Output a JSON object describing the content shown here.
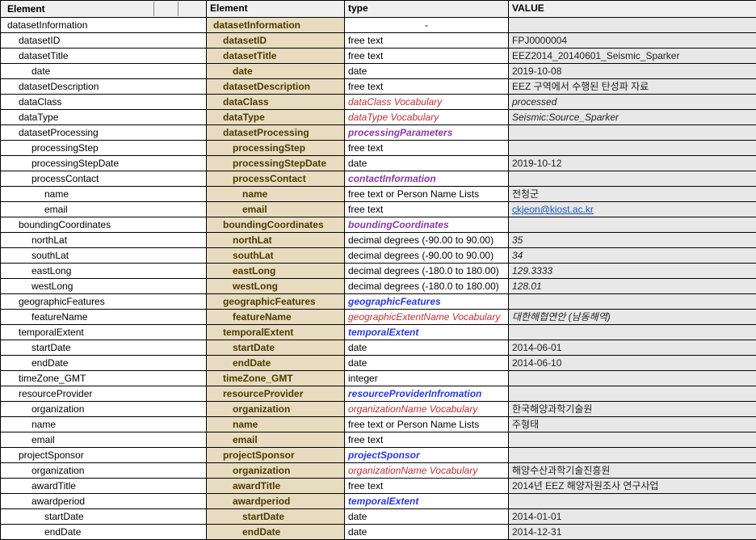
{
  "headers": {
    "colA": "Element",
    "colB": "Element",
    "colC": "type",
    "colD": "VALUE"
  },
  "rows": [
    {
      "tree": "datasetInformation",
      "ti": 0,
      "el": "datasetInformation",
      "ind": 0,
      "type": "-",
      "tstyle": "center",
      "val": ""
    },
    {
      "tree": "datasetID",
      "ti": 1,
      "el": "datasetID",
      "ind": 1,
      "type": "free text",
      "tstyle": "normal",
      "val": "FPJ0000004"
    },
    {
      "tree": "datasetTitle",
      "ti": 1,
      "el": "datasetTitle",
      "ind": 1,
      "type": "free text",
      "tstyle": "normal",
      "val": "EEZ2014_20140601_Seismic_Sparker"
    },
    {
      "tree": "date",
      "ti": 2,
      "el": "date",
      "ind": 2,
      "type": "date",
      "tstyle": "normal",
      "val": "2019-10-08"
    },
    {
      "tree": "datasetDescription",
      "ti": 1,
      "el": "datasetDescription",
      "ind": 1,
      "type": "free text",
      "tstyle": "normal",
      "val": "EEZ 구역에서 수행된 탄성파 자료"
    },
    {
      "tree": "dataClass",
      "ti": 1,
      "el": "dataClass",
      "ind": 1,
      "type": "dataClass Vocabulary",
      "tstyle": "red",
      "val": "processed",
      "vitalic": true
    },
    {
      "tree": "dataType",
      "ti": 1,
      "el": "dataType",
      "ind": 1,
      "type": "dataType Vocabulary",
      "tstyle": "red",
      "val": "Seismic:Source_Sparker",
      "vitalic": true
    },
    {
      "tree": "datasetProcessing",
      "ti": 1,
      "el": "datasetProcessing",
      "ind": 1,
      "type": "processingParameters",
      "tstyle": "purple",
      "val": ""
    },
    {
      "tree": "processingStep",
      "ti": 2,
      "el": "processingStep",
      "ind": 2,
      "type": "free text",
      "tstyle": "normal",
      "val": ""
    },
    {
      "tree": "processingStepDate",
      "ti": 2,
      "el": "processingStepDate",
      "ind": 2,
      "type": "date",
      "tstyle": "normal",
      "val": "2019-10-12"
    },
    {
      "tree": "processContact",
      "ti": 2,
      "el": "processContact",
      "ind": 2,
      "type": "contactInformation",
      "tstyle": "purple",
      "val": ""
    },
    {
      "tree": "name",
      "ti": 3,
      "el": "name",
      "ind": 3,
      "type": "free text or Person Name Lists",
      "tstyle": "normal",
      "val": "전청군"
    },
    {
      "tree": "email",
      "ti": 3,
      "el": "email",
      "ind": 3,
      "type": "free text",
      "tstyle": "normal",
      "val": "ckjeon@kiost.ac.kr",
      "vlink": true
    },
    {
      "tree": "boundingCoordinates",
      "ti": 1,
      "el": "boundingCoordinates",
      "ind": 1,
      "type": "boundingCoordinates",
      "tstyle": "purple",
      "val": ""
    },
    {
      "tree": "northLat",
      "ti": 2,
      "el": "northLat",
      "ind": 2,
      "type": "decimal degrees (-90.00 to 90.00)",
      "tstyle": "normal",
      "val": "35",
      "vitalic": true
    },
    {
      "tree": "southLat",
      "ti": 2,
      "el": "southLat",
      "ind": 2,
      "type": "decimal degrees (-90.00 to 90.00)",
      "tstyle": "normal",
      "val": "34",
      "vitalic": true
    },
    {
      "tree": "eastLong",
      "ti": 2,
      "el": "eastLong",
      "ind": 2,
      "type": "decimal degrees (-180.0 to 180.00)",
      "tstyle": "normal",
      "val": "129.3333",
      "vitalic": true
    },
    {
      "tree": "westLong",
      "ti": 2,
      "el": "westLong",
      "ind": 2,
      "type": "decimal degrees (-180.0 to 180.00)",
      "tstyle": "normal",
      "val": "128.01",
      "vitalic": true
    },
    {
      "tree": "geographicFeatures",
      "ti": 1,
      "el": "geographicFeatures",
      "ind": 1,
      "type": "geographicFeatures",
      "tstyle": "blue",
      "val": ""
    },
    {
      "tree": "featureName",
      "ti": 2,
      "el": "featureName",
      "ind": 2,
      "type": "geographicExtentName Vocabulary",
      "tstyle": "red",
      "val": "대한해협연안 (남동해역)",
      "vitalic": true
    },
    {
      "tree": "temporalExtent",
      "ti": 1,
      "el": "temporalExtent",
      "ind": 1,
      "type": "temporalExtent",
      "tstyle": "blue",
      "val": ""
    },
    {
      "tree": "startDate",
      "ti": 2,
      "el": "startDate",
      "ind": 2,
      "type": "date",
      "tstyle": "normal",
      "val": "2014-06-01"
    },
    {
      "tree": "endDate",
      "ti": 2,
      "el": "endDate",
      "ind": 2,
      "type": "date",
      "tstyle": "normal",
      "val": "2014-06-10"
    },
    {
      "tree": "timeZone_GMT",
      "ti": 1,
      "el": "timeZone_GMT",
      "ind": 1,
      "type": "integer",
      "tstyle": "normal",
      "val": ""
    },
    {
      "tree": "resourceProvider",
      "ti": 1,
      "el": "resourceProvider",
      "ind": 1,
      "type": "resourceProviderInfromation",
      "tstyle": "blue",
      "val": ""
    },
    {
      "tree": "organization",
      "ti": 2,
      "el": "organization",
      "ind": 2,
      "type": "organizationName Vocabulary",
      "tstyle": "red",
      "val": "한국해양과학기술원"
    },
    {
      "tree": "name",
      "ti": 2,
      "el": "name",
      "ind": 2,
      "type": "free text or Person Name Lists",
      "tstyle": "normal",
      "val": "주형태"
    },
    {
      "tree": "email",
      "ti": 2,
      "el": "email",
      "ind": 2,
      "type": "free text",
      "tstyle": "normal",
      "val": ""
    },
    {
      "tree": "projectSponsor",
      "ti": 1,
      "el": "projectSponsor",
      "ind": 1,
      "type": "projectSponsor",
      "tstyle": "blue",
      "val": ""
    },
    {
      "tree": "organization",
      "ti": 2,
      "el": "organization",
      "ind": 2,
      "type": "organizationName Vocabulary",
      "tstyle": "red",
      "val": "해양수산과학기술진흥원"
    },
    {
      "tree": "awardTitle",
      "ti": 2,
      "el": "awardTitle",
      "ind": 2,
      "type": "free text",
      "tstyle": "normal",
      "val": "2014년 EEZ 해양자원조사 연구사업"
    },
    {
      "tree": "awardperiod",
      "ti": 2,
      "el": "awardperiod",
      "ind": 2,
      "type": "temporalExtent",
      "tstyle": "blue",
      "val": ""
    },
    {
      "tree": "startDate",
      "ti": 3,
      "el": "startDate",
      "ind": 3,
      "type": "date",
      "tstyle": "normal",
      "val": "2014-01-01"
    },
    {
      "tree": "endDate",
      "ti": 3,
      "el": "endDate",
      "ind": 3,
      "type": "date",
      "tstyle": "normal",
      "val": "2014-12-31"
    }
  ]
}
